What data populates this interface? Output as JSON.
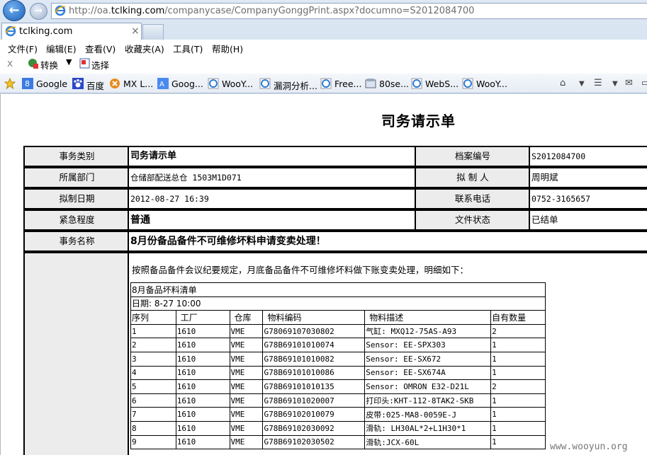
{
  "browser": {
    "url_prefix": "http://oa.",
    "url_domain": "tclking.com",
    "url_path": "/companycase/CompanyGonggPrint.aspx?documno=S2012084700",
    "tab_title": "tclking.com",
    "menu": [
      "文件(F)",
      "编辑(E)",
      "查看(V)",
      "收藏夹(A)",
      "工具(T)",
      "帮助(H)"
    ],
    "commands": {
      "convert": "转换",
      "select": "选择"
    },
    "favorites": [
      "Google",
      "百度",
      "MX L...",
      "Goog...",
      "WooY...",
      "漏洞分析...",
      "Free...",
      "80se...",
      "WebS...",
      "WooY..."
    ]
  },
  "document": {
    "title": "司务请示单",
    "fields": {
      "type_label": "事务类别",
      "type_value": "司务请示单",
      "archive_label": "档案编号",
      "archive_value": "S2012084700",
      "dept_label": "所属部门",
      "dept_value": "仓储部配送总仓 1503M1D071",
      "author_label": "拟 制 人",
      "author_value": "周明斌",
      "date_label": "拟制日期",
      "date_value": "2012-08-27 16:39",
      "phone_label": "联系电话",
      "phone_value": "0752-3165657",
      "urgency_label": "紧急程度",
      "urgency_value": "普通",
      "status_label": "文件状态",
      "status_value": "已结单",
      "subject_label": "事务名称",
      "subject_value": "8月份备品备件不可维修坏料申请变卖处理！"
    },
    "intro": "按照备品备件会议纪要规定，月底备品备件不可维修坏料做下账变卖处理，明细如下：",
    "list_title": "8月备品坏料清单",
    "list_date": "日期: 8-27 10:00",
    "columns": [
      "序列",
      "工厂",
      "仓库",
      "物料编码",
      "物料描述",
      "自有数量"
    ],
    "rows": [
      [
        "1",
        "1610",
        "VME",
        "G78069107030802",
        "气缸: MXQ12-75AS-A93",
        "2"
      ],
      [
        "2",
        "1610",
        "VME",
        "G78B69101010074",
        "Sensor: EE-SPX303",
        "1"
      ],
      [
        "3",
        "1610",
        "VME",
        "G78B69101010082",
        "Sensor: EE-SX672",
        "1"
      ],
      [
        "4",
        "1610",
        "VME",
        "G78B69101010086",
        "Sensor: EE-SX674A",
        "1"
      ],
      [
        "5",
        "1610",
        "VME",
        "G78B69101010135",
        "Sensor: OMRON E32-D21L",
        "2"
      ],
      [
        "6",
        "1610",
        "VME",
        "G78B69101020007",
        "打印头:KHT-112-8TAK2-SKB",
        "1"
      ],
      [
        "7",
        "1610",
        "VME",
        "G78B69102010079",
        "皮带:025-MA8-0059E-J",
        "1"
      ],
      [
        "8",
        "1610",
        "VME",
        "G78B69102030092",
        "滑轨: LH30AL*2+L1H30*1",
        "1"
      ],
      [
        "9",
        "1610",
        "VME",
        "G78B69102030502",
        "滑轨:JCX-60L",
        "1"
      ]
    ]
  },
  "watermark": "www.wooyun.org"
}
